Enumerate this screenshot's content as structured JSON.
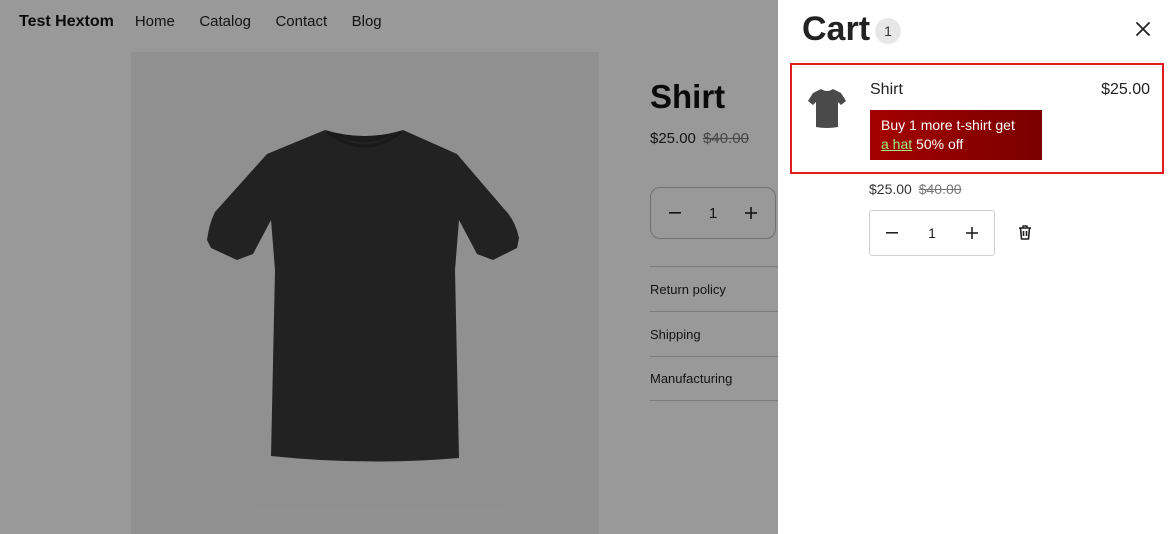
{
  "store": {
    "brand": "Test Hextom",
    "nav": [
      {
        "label": "Home"
      },
      {
        "label": "Catalog"
      },
      {
        "label": "Contact"
      },
      {
        "label": "Blog"
      }
    ]
  },
  "product": {
    "title": "Shirt",
    "price": "$25.00",
    "compare_price": "$40.00",
    "quantity": "1",
    "accordion": [
      {
        "label": "Return policy"
      },
      {
        "label": "Shipping"
      },
      {
        "label": "Manufacturing"
      }
    ]
  },
  "cart": {
    "title": "Cart",
    "count": "1",
    "item": {
      "name": "Shirt",
      "line_total": "$25.00",
      "promo_prefix": "Buy 1 more t-shirt get",
      "promo_link": "a hat",
      "promo_suffix": "50% off",
      "price": "$25.00",
      "compare_price": "$40.00",
      "quantity": "1"
    }
  },
  "colors": {
    "highlight_border": "#e01e1e",
    "promo_background": "#8b0000",
    "promo_link": "#9ef07a",
    "overlay": "rgba(0,0,0,0.40)"
  },
  "icons": {
    "close": "close-icon",
    "minus": "minus-icon",
    "plus": "plus-icon",
    "delete": "trash-icon"
  }
}
